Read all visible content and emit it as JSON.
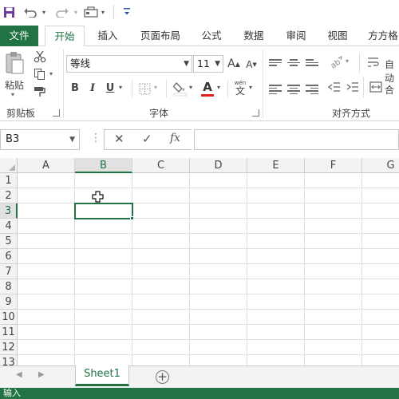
{
  "qat": {
    "icons": [
      "save-icon",
      "undo-icon",
      "redo-icon",
      "form-icon",
      "customize-icon"
    ]
  },
  "ribbon_tabs": [
    "文件",
    "开始",
    "插入",
    "页面布局",
    "公式",
    "数据",
    "审阅",
    "视图",
    "方方格"
  ],
  "active_tab": "开始",
  "clipboard": {
    "paste_label": "粘贴",
    "group_label": "剪贴板"
  },
  "font": {
    "name": "等线",
    "size": "11",
    "bold": "B",
    "italic": "I",
    "underline": "U",
    "font_color": "A",
    "phonetic_top": "wén",
    "phonetic_bottom": "文",
    "grow": "A",
    "shrink": "A",
    "group_label": "字体"
  },
  "alignment": {
    "group_label": "对齐方式",
    "wrap_label": "自动"
  },
  "formula_bar": {
    "name_box": "B3",
    "cancel": "✕",
    "enter": "✓",
    "fx": "fx",
    "value": ""
  },
  "columns": [
    "A",
    "B",
    "C",
    "D",
    "E",
    "F",
    "G"
  ],
  "rows": [
    "1",
    "2",
    "3",
    "4",
    "5",
    "6",
    "7",
    "8",
    "9",
    "10",
    "11",
    "12",
    "13"
  ],
  "selected_cell": {
    "column": "B",
    "row": "3"
  },
  "sheets": [
    "Sheet1"
  ],
  "active_sheet": "Sheet1",
  "status": "输入",
  "colors": {
    "accent": "#217346",
    "font_color_bar": "#e02020"
  }
}
